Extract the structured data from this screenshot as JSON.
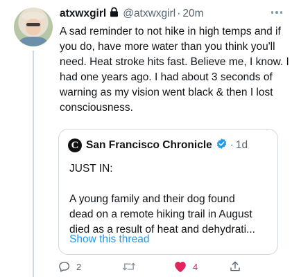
{
  "tweet": {
    "author_name": "atxwxgirl",
    "handle": "@atxwxgirl",
    "separator": "·",
    "time": "20m",
    "text": "A sad reminder to not hike in high temps and if you do, have more water than you think you'll need. Heat stroke hits fast. Believe me, I know. I had one years ago. I had about 3 seconds of warning as my vision went black & then I lost consciousness."
  },
  "quoted": {
    "logo_letter": "C",
    "author_name": "San Francisco Chronicle",
    "separator": "·",
    "time": "1d",
    "line1": "JUST IN:",
    "line2": "A young family and their dog found",
    "line3": "dead on a remote hiking trail in August",
    "line4": "died as a result of heat and dehydrati...",
    "show_thread": "Show this thread"
  },
  "actions": {
    "reply_count": "2",
    "retweet_count": "",
    "like_count": "4"
  },
  "colors": {
    "accent": "#1d9bf0",
    "like": "#e0245e",
    "muted": "#536471",
    "border": "#cfd9de"
  },
  "icons": {
    "lock": "lock-icon",
    "verified": "verified-badge-icon",
    "more": "more-options-icon",
    "reply": "reply-icon",
    "retweet": "retweet-icon",
    "like": "heart-icon",
    "share": "share-icon"
  }
}
